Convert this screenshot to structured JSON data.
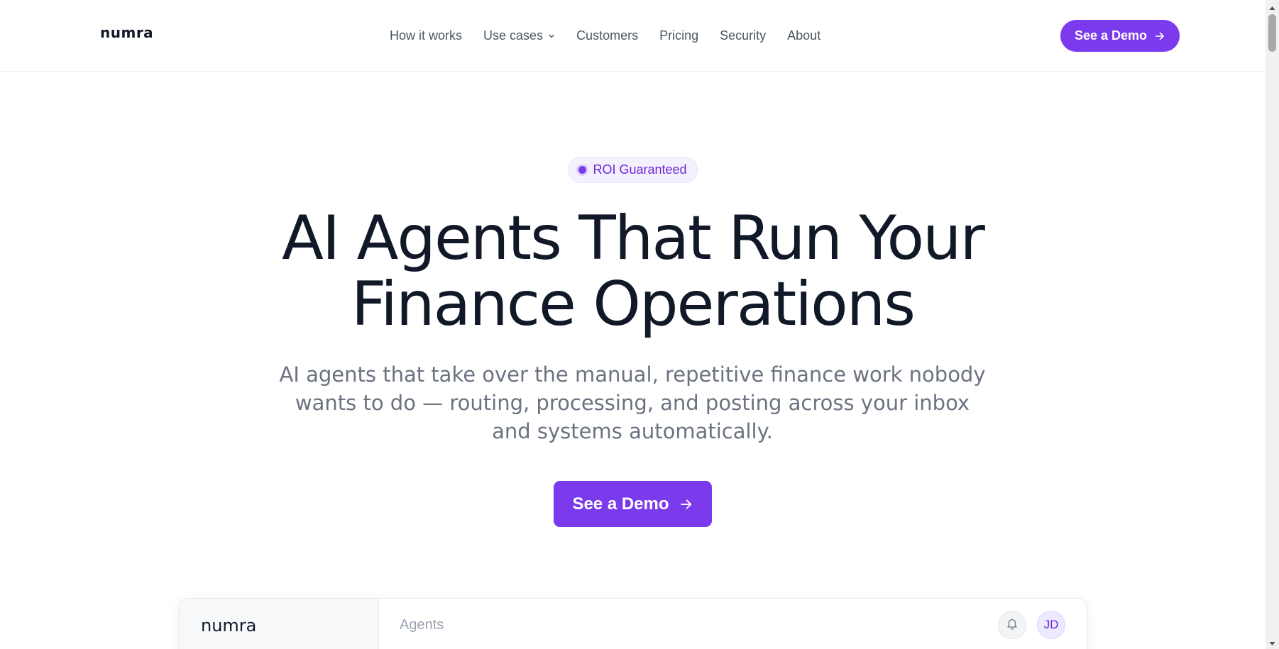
{
  "header": {
    "logo": "numra",
    "nav": [
      {
        "label": "How it works"
      },
      {
        "label": "Use cases",
        "has_dropdown": true
      },
      {
        "label": "Customers"
      },
      {
        "label": "Pricing"
      },
      {
        "label": "Security"
      },
      {
        "label": "About"
      }
    ],
    "cta_label": "See a Demo"
  },
  "hero": {
    "badge": "ROI Guaranteed",
    "title_line1": "AI Agents That Run Your",
    "title_line2": "Finance Operations",
    "subtitle": "AI agents that take over the manual, repetitive finance work nobody wants to do — routing, processing, and posting across your inbox and systems automatically.",
    "cta_label": "See a Demo"
  },
  "preview": {
    "logo": "numra",
    "page_title": "Agents",
    "avatar_initials": "JD"
  },
  "colors": {
    "accent": "#7c3aed",
    "text": "#111827",
    "muted": "#6b7280"
  },
  "icons": {
    "dropdown": "chevron-down-icon",
    "cta_arrow": "arrow-right-icon",
    "notifications": "bell-icon"
  }
}
